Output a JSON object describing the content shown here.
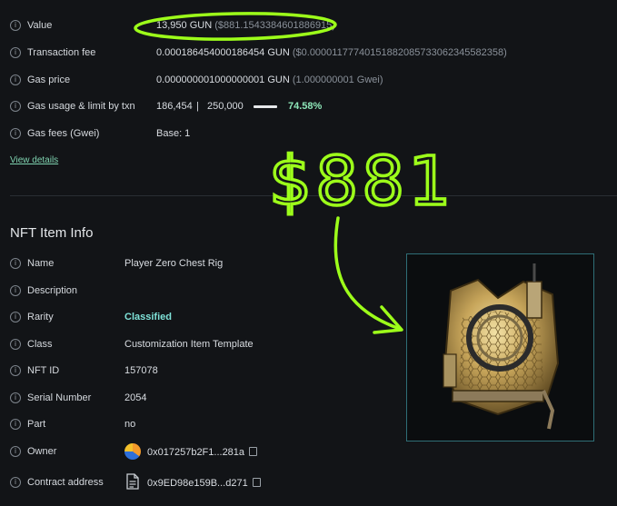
{
  "tx": {
    "value_label": "Value",
    "value": "13,950 GUN",
    "value_usd": "($881.1543384601886915)",
    "fee_label": "Transaction fee",
    "fee": "0.000186454000186454 GUN",
    "fee_usd": "($0.00001177740151882085733062345582358)",
    "gas_price_label": "Gas price",
    "gas_price": "0.000000001000000001 GUN",
    "gas_price_gwei": "(1.000000001 Gwei)",
    "gas_usage_label": "Gas usage & limit by txn",
    "gas_used": "186,454",
    "gas_sep": "|",
    "gas_limit": "250,000",
    "gas_pct": "74.58%",
    "gas_pct_value": 74.58,
    "gas_fees_label": "Gas fees (Gwei)",
    "gas_fees_base": "Base: 1",
    "view_details": "View details"
  },
  "annotation": {
    "price_text": "$881",
    "color": "#9dff1a"
  },
  "nft": {
    "section_title": "NFT Item Info",
    "name_label": "Name",
    "name": "Player Zero Chest Rig",
    "description_label": "Description",
    "rarity_label": "Rarity",
    "rarity": "Classified",
    "class_label": "Class",
    "class": "Customization Item Template",
    "nft_id_label": "NFT ID",
    "nft_id": "157078",
    "serial_label": "Serial Number",
    "serial": "2054",
    "part_label": "Part",
    "part": "no",
    "owner_label": "Owner",
    "owner": "0x017257b2F1...281a",
    "contract_label": "Contract address",
    "contract": "0x9ED98e159B...d271"
  },
  "icons": {
    "info": "info-icon",
    "copy": "copy-icon",
    "document": "document-icon",
    "avatar": "owner-avatar"
  }
}
